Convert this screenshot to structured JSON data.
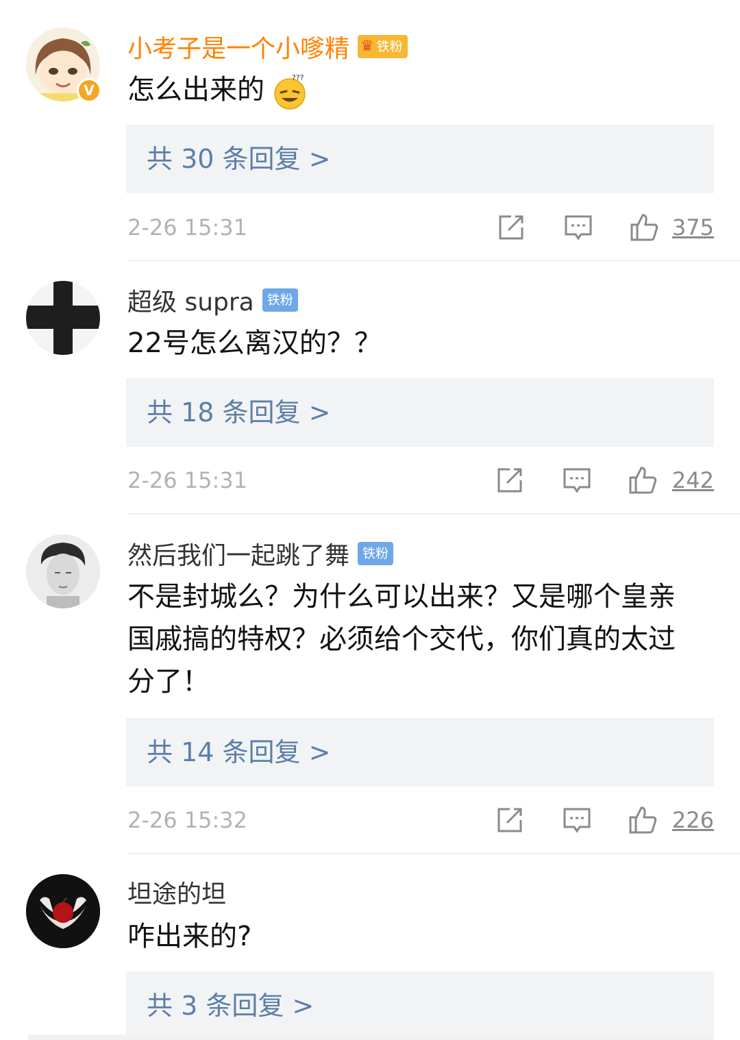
{
  "comments": [
    {
      "name": "小考子是一个小嗲精",
      "badge": "铁粉",
      "verified": "V",
      "text": "怎么出来的",
      "emoji_icon": "dizzy-smile-emoji",
      "reply_link": "共 30 条回复 >",
      "time": "2-26 15:31",
      "likes": "375"
    },
    {
      "name": "超级 supra",
      "badge": "铁粉",
      "text": "22号怎么离汉的？？",
      "reply_link": "共 18 条回复 >",
      "time": "2-26 15:31",
      "likes": "242"
    },
    {
      "name": "然后我们一起跳了舞",
      "badge": "铁粉",
      "text": "不是封城么？为什么可以出来？又是哪个皇亲国戚搞的特权？必须给个交代，你们真的太过分了！",
      "reply_link": "共 14 条回复 >",
      "time": "2-26 15:32",
      "likes": "226"
    },
    {
      "name": "坦途的坦",
      "text": "咋出来的?",
      "reply_link": "共 3 条回复 >"
    }
  ],
  "icons": {
    "share": "share-icon",
    "comment": "comment-icon",
    "like": "thumbs-up-icon"
  }
}
